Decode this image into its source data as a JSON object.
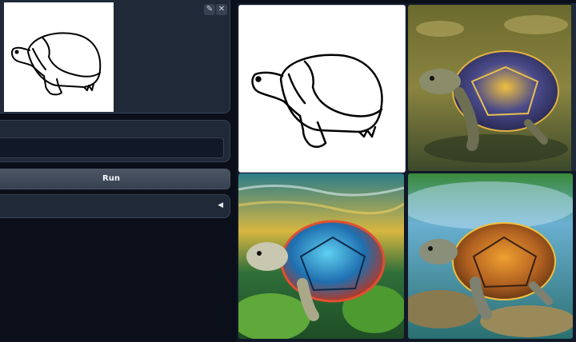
{
  "sketch": {
    "edit_icon": "pencil-icon",
    "close_icon": "close-icon"
  },
  "prompt": {
    "value": "",
    "placeholder": ""
  },
  "actions": {
    "run_label": "Run"
  },
  "advanced": {
    "arrow_icon": "triangle-left-icon"
  },
  "gallery": {
    "images": [
      {
        "name": "turtle-sketch-output"
      },
      {
        "name": "turtle-in-water"
      },
      {
        "name": "turtle-underwater-colorful"
      },
      {
        "name": "turtle-on-rocks"
      }
    ]
  },
  "colors": {
    "background": "#0b0f19",
    "panel": "#1f2937",
    "border": "#374151"
  }
}
